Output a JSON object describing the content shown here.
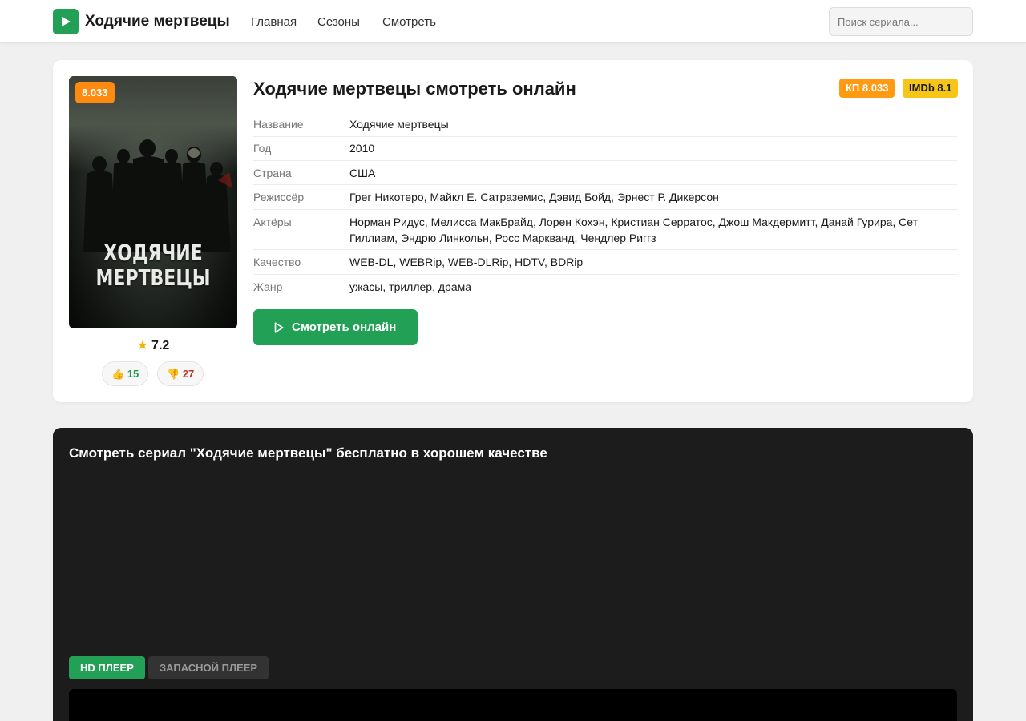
{
  "header": {
    "logo_text": "Ходячие мертвецы",
    "nav": [
      "Главная",
      "Сезоны",
      "Смотреть"
    ],
    "search_placeholder": "Поиск сериала..."
  },
  "movie": {
    "poster_badge": "8.033",
    "poster_title": "ХОДЯЧИЕ МЕРТВЕЦЫ",
    "user_rating": "7.2",
    "likes": "15",
    "dislikes": "27",
    "title": "Ходячие мертвецы смотреть онлайн",
    "badge_kp": "КП 8.033",
    "badge_imdb": "IMDb 8.1",
    "info": [
      {
        "label": "Название",
        "value": "Ходячие мертвецы"
      },
      {
        "label": "Год",
        "value": "2010"
      },
      {
        "label": "Страна",
        "value": "США"
      },
      {
        "label": "Режиссёр",
        "value": "Грег Никотеро, Майкл Е. Сатраземис, Дэвид Бойд, Эрнест Р. Дикерсон"
      },
      {
        "label": "Актёры",
        "value": "Норман Ридус, Мелисса МакБрайд, Лорен Кохэн, Кристиан Серратос, Джош Макдермитт, Данай Гурира, Сет Гиллиам, Эндрю Линкольн, Росс Маркванд, Чендлер Риггз"
      },
      {
        "label": "Качество",
        "value": "WEB-DL, WEBRip, WEB-DLRip, HDTV, BDRip"
      },
      {
        "label": "Жанр",
        "value": "ужасы, триллер, драма"
      }
    ],
    "watch_button": "Смотреть онлайн"
  },
  "player": {
    "title": "Смотреть сериал \"Ходячие мертвецы\" бесплатно в хорошем качестве",
    "tabs": [
      "HD ПЛЕЕР",
      "ЗАПАСНОЙ ПЛЕЕР"
    ]
  },
  "colors": {
    "accent": "#22a055",
    "kp_badge": "#ff9a12",
    "imdb_badge": "#f5c518",
    "player_bg": "#1c1c1c"
  },
  "icons": [
    "play-icon",
    "star-icon",
    "thumbs-up-icon",
    "thumbs-down-icon"
  ]
}
